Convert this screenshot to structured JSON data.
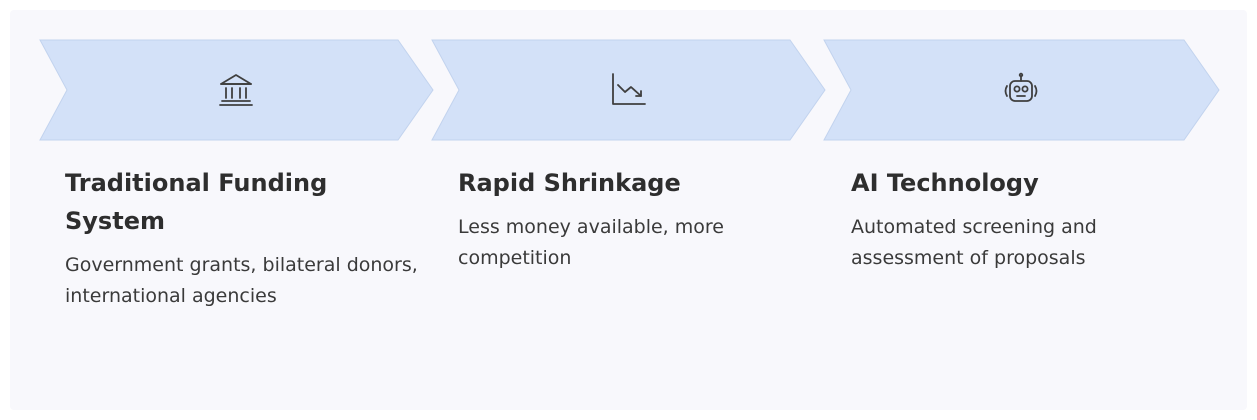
{
  "colors": {
    "chevron_fill": "#d3e1f8",
    "chevron_stroke": "#c2d3ee",
    "icon_stroke": "#3f3f3f",
    "background": "#f8f8fc"
  },
  "steps": [
    {
      "icon": "bank-icon",
      "title": "Traditional Funding System",
      "description": "Government grants, bilateral donors, international agencies"
    },
    {
      "icon": "chart-down-icon",
      "title": "Rapid Shrinkage",
      "description": "Less money available, more competition"
    },
    {
      "icon": "robot-icon",
      "title": "AI Technology",
      "description": "Automated screening and assessment of proposals"
    }
  ]
}
